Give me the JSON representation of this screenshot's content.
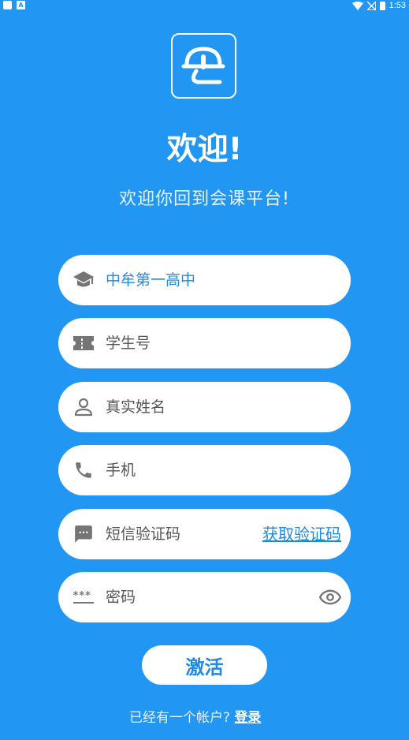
{
  "status_bar": {
    "time": "1:53",
    "notification_letter": "A"
  },
  "header": {
    "title": "欢迎!",
    "subtitle": "欢迎你回到会课平台!"
  },
  "form": {
    "school": {
      "value": "中牟第一高中",
      "icon": "school-icon"
    },
    "student_id": {
      "placeholder": "学生号",
      "icon": "id-card-icon"
    },
    "real_name": {
      "placeholder": "真实姓名",
      "icon": "person-icon"
    },
    "phone": {
      "placeholder": "手机",
      "icon": "phone-icon"
    },
    "sms_code": {
      "placeholder": "短信验证码",
      "icon": "sms-icon",
      "get_code_label": "获取验证码"
    },
    "password": {
      "placeholder": "密码",
      "icon": "password-icon",
      "toggle_icon": "eye-icon"
    }
  },
  "actions": {
    "activate_label": "激活",
    "footer_text": "已经有一个帐户?",
    "login_label": "登录"
  },
  "colors": {
    "background": "#2196F3",
    "accent": "#1E88E5",
    "icon_gray": "#757575"
  }
}
